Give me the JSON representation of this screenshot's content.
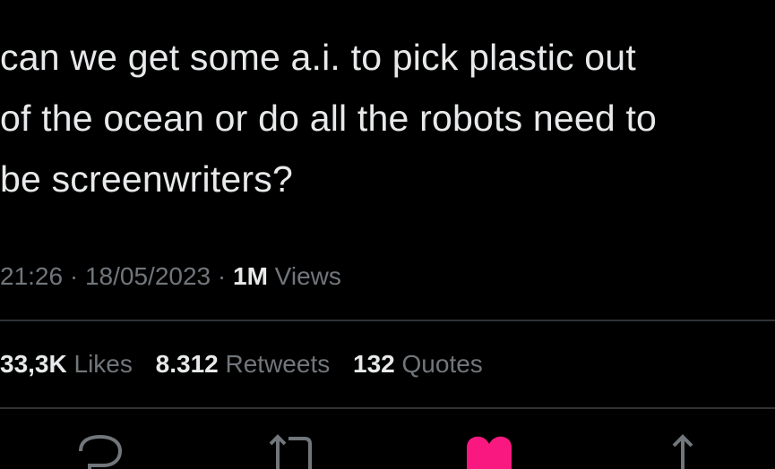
{
  "tweet": {
    "text": "can we get some a.i. to pick plastic out\nof the ocean or do all the robots need to\nbe screenwriters?",
    "time": "21:26",
    "separator": " · ",
    "date": "18/05/2023",
    "views_count": "1M",
    "views_label": " Views"
  },
  "stats": {
    "likes_count": "33,3K",
    "likes_label": " Likes",
    "retweets_count": "8.312",
    "retweets_label": " Retweets",
    "quotes_count": "132",
    "quotes_label": " Quotes"
  },
  "actions": {
    "reply_icon": "reply-icon",
    "retweet_icon": "retweet-icon",
    "like_icon": "like-icon",
    "share_icon": "share-icon"
  },
  "colors": {
    "background": "#000000",
    "text": "#e7e9ea",
    "muted": "#71767b",
    "divider": "#2f3336",
    "like_active": "#f91880"
  }
}
